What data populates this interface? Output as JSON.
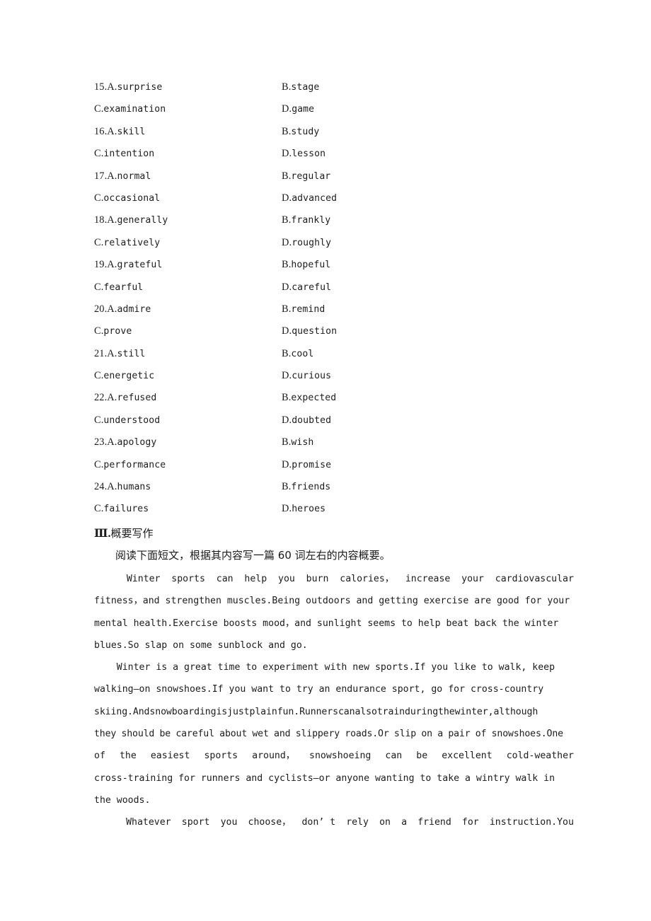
{
  "document": {
    "type": "exam-worksheet-page",
    "language": "zh-CN + en"
  },
  "multiple_choice": {
    "questions": [
      {
        "number": "15.",
        "a_letter": "A.",
        "a": "surprise",
        "b_letter": "B.",
        "b": "stage",
        "c_letter": "C.",
        "c": "examination",
        "d_letter": "D.",
        "d": "game"
      },
      {
        "number": "16.",
        "a_letter": "A.",
        "a": "skill",
        "b_letter": "B.",
        "b": "study",
        "c_letter": "C.",
        "c": "intention",
        "d_letter": "D.",
        "d": "lesson"
      },
      {
        "number": "17.",
        "a_letter": "A.",
        "a": "normal",
        "b_letter": "B.",
        "b": "regular",
        "c_letter": "C.",
        "c": "occasional",
        "d_letter": "D.",
        "d": "advanced"
      },
      {
        "number": "18.",
        "a_letter": "A.",
        "a": "generally",
        "b_letter": "B.",
        "b": "frankly",
        "c_letter": "C.",
        "c": "relatively",
        "d_letter": "D.",
        "d": "roughly"
      },
      {
        "number": "19.",
        "a_letter": "A.",
        "a": "grateful",
        "b_letter": "B.",
        "b": "hopeful",
        "c_letter": "C.",
        "c": "fearful",
        "d_letter": "D.",
        "d": "careful"
      },
      {
        "number": "20.",
        "a_letter": "A.",
        "a": "admire",
        "b_letter": "B.",
        "b": "remind",
        "c_letter": "C.",
        "c": "prove",
        "d_letter": "D.",
        "d": "question"
      },
      {
        "number": "21.",
        "a_letter": "A.",
        "a": "still",
        "b_letter": "B.",
        "b": "cool",
        "c_letter": "C.",
        "c": "energetic",
        "d_letter": "D.",
        "d": "curious"
      },
      {
        "number": "22.",
        "a_letter": "A.",
        "a": "refused",
        "b_letter": "B.",
        "b": "expected",
        "c_letter": "C.",
        "c": "understood",
        "d_letter": "D.",
        "d": "doubted"
      },
      {
        "number": "23.",
        "a_letter": "A.",
        "a": "apology",
        "b_letter": "B.",
        "b": "wish",
        "c_letter": "C.",
        "c": "performance",
        "d_letter": "D.",
        "d": "promise"
      },
      {
        "number": "24.",
        "a_letter": "A.",
        "a": "humans",
        "b_letter": "B.",
        "b": "friends",
        "c_letter": "C.",
        "c": "failures",
        "d_letter": "D.",
        "d": "heroes"
      }
    ]
  },
  "section": {
    "roman": "Ⅲ.",
    "title": "概要写作",
    "instruction": "阅读下面短文，根据其内容写一篇 60 词左右的内容概要。"
  },
  "passage": {
    "paragraphs": [
      {
        "lines": [
          {
            "indent": true,
            "justify": true,
            "words": [
              "Winter",
              "sports",
              "can",
              "help",
              "you",
              "burn",
              "calories，",
              "increase",
              "your",
              "cardiovascular"
            ]
          },
          {
            "indent": false,
            "justify": false,
            "text": "fitness，and strengthen muscles.Being outdoors and getting exercise are good for your"
          },
          {
            "indent": false,
            "justify": false,
            "text": "mental health.Exercise boosts mood，and sunlight seems to help beat back the winter"
          },
          {
            "indent": false,
            "justify": false,
            "text": "blues.So slap on some sunblock and go."
          }
        ]
      },
      {
        "lines": [
          {
            "indent": true,
            "justify": false,
            "text": "Winter is a great time to experiment with new sports.If you like to walk, keep"
          },
          {
            "indent": false,
            "justify": false,
            "text": "walking—on snowshoes.If you want to try an endurance sport, go for cross-country"
          },
          {
            "indent": false,
            "justify": false,
            "condensed": true,
            "text": "skiing.Andsnowboardingisjustplainfun.Runnerscanalsotrainduringthewinter,although"
          },
          {
            "indent": false,
            "justify": false,
            "tight": true,
            "text": "they should be careful about wet and slippery roads.Or slip on a pair of snowshoes.One"
          },
          {
            "indent": false,
            "justify": true,
            "words": [
              "of",
              "the",
              "easiest",
              "sports",
              "around，",
              "snowshoeing",
              "can",
              "be",
              "excellent",
              "cold-weather"
            ]
          },
          {
            "indent": false,
            "justify": false,
            "text": "cross-training for runners and cyclists—or anyone wanting to take a wintry walk in"
          },
          {
            "indent": false,
            "justify": false,
            "text": "the woods."
          }
        ]
      },
      {
        "lines": [
          {
            "indent": true,
            "justify": true,
            "words": [
              "Whatever",
              "sport",
              "you",
              "choose，",
              "don’ t",
              "rely",
              "on",
              "a",
              "friend",
              "for",
              "instruction.You"
            ]
          }
        ]
      }
    ]
  }
}
